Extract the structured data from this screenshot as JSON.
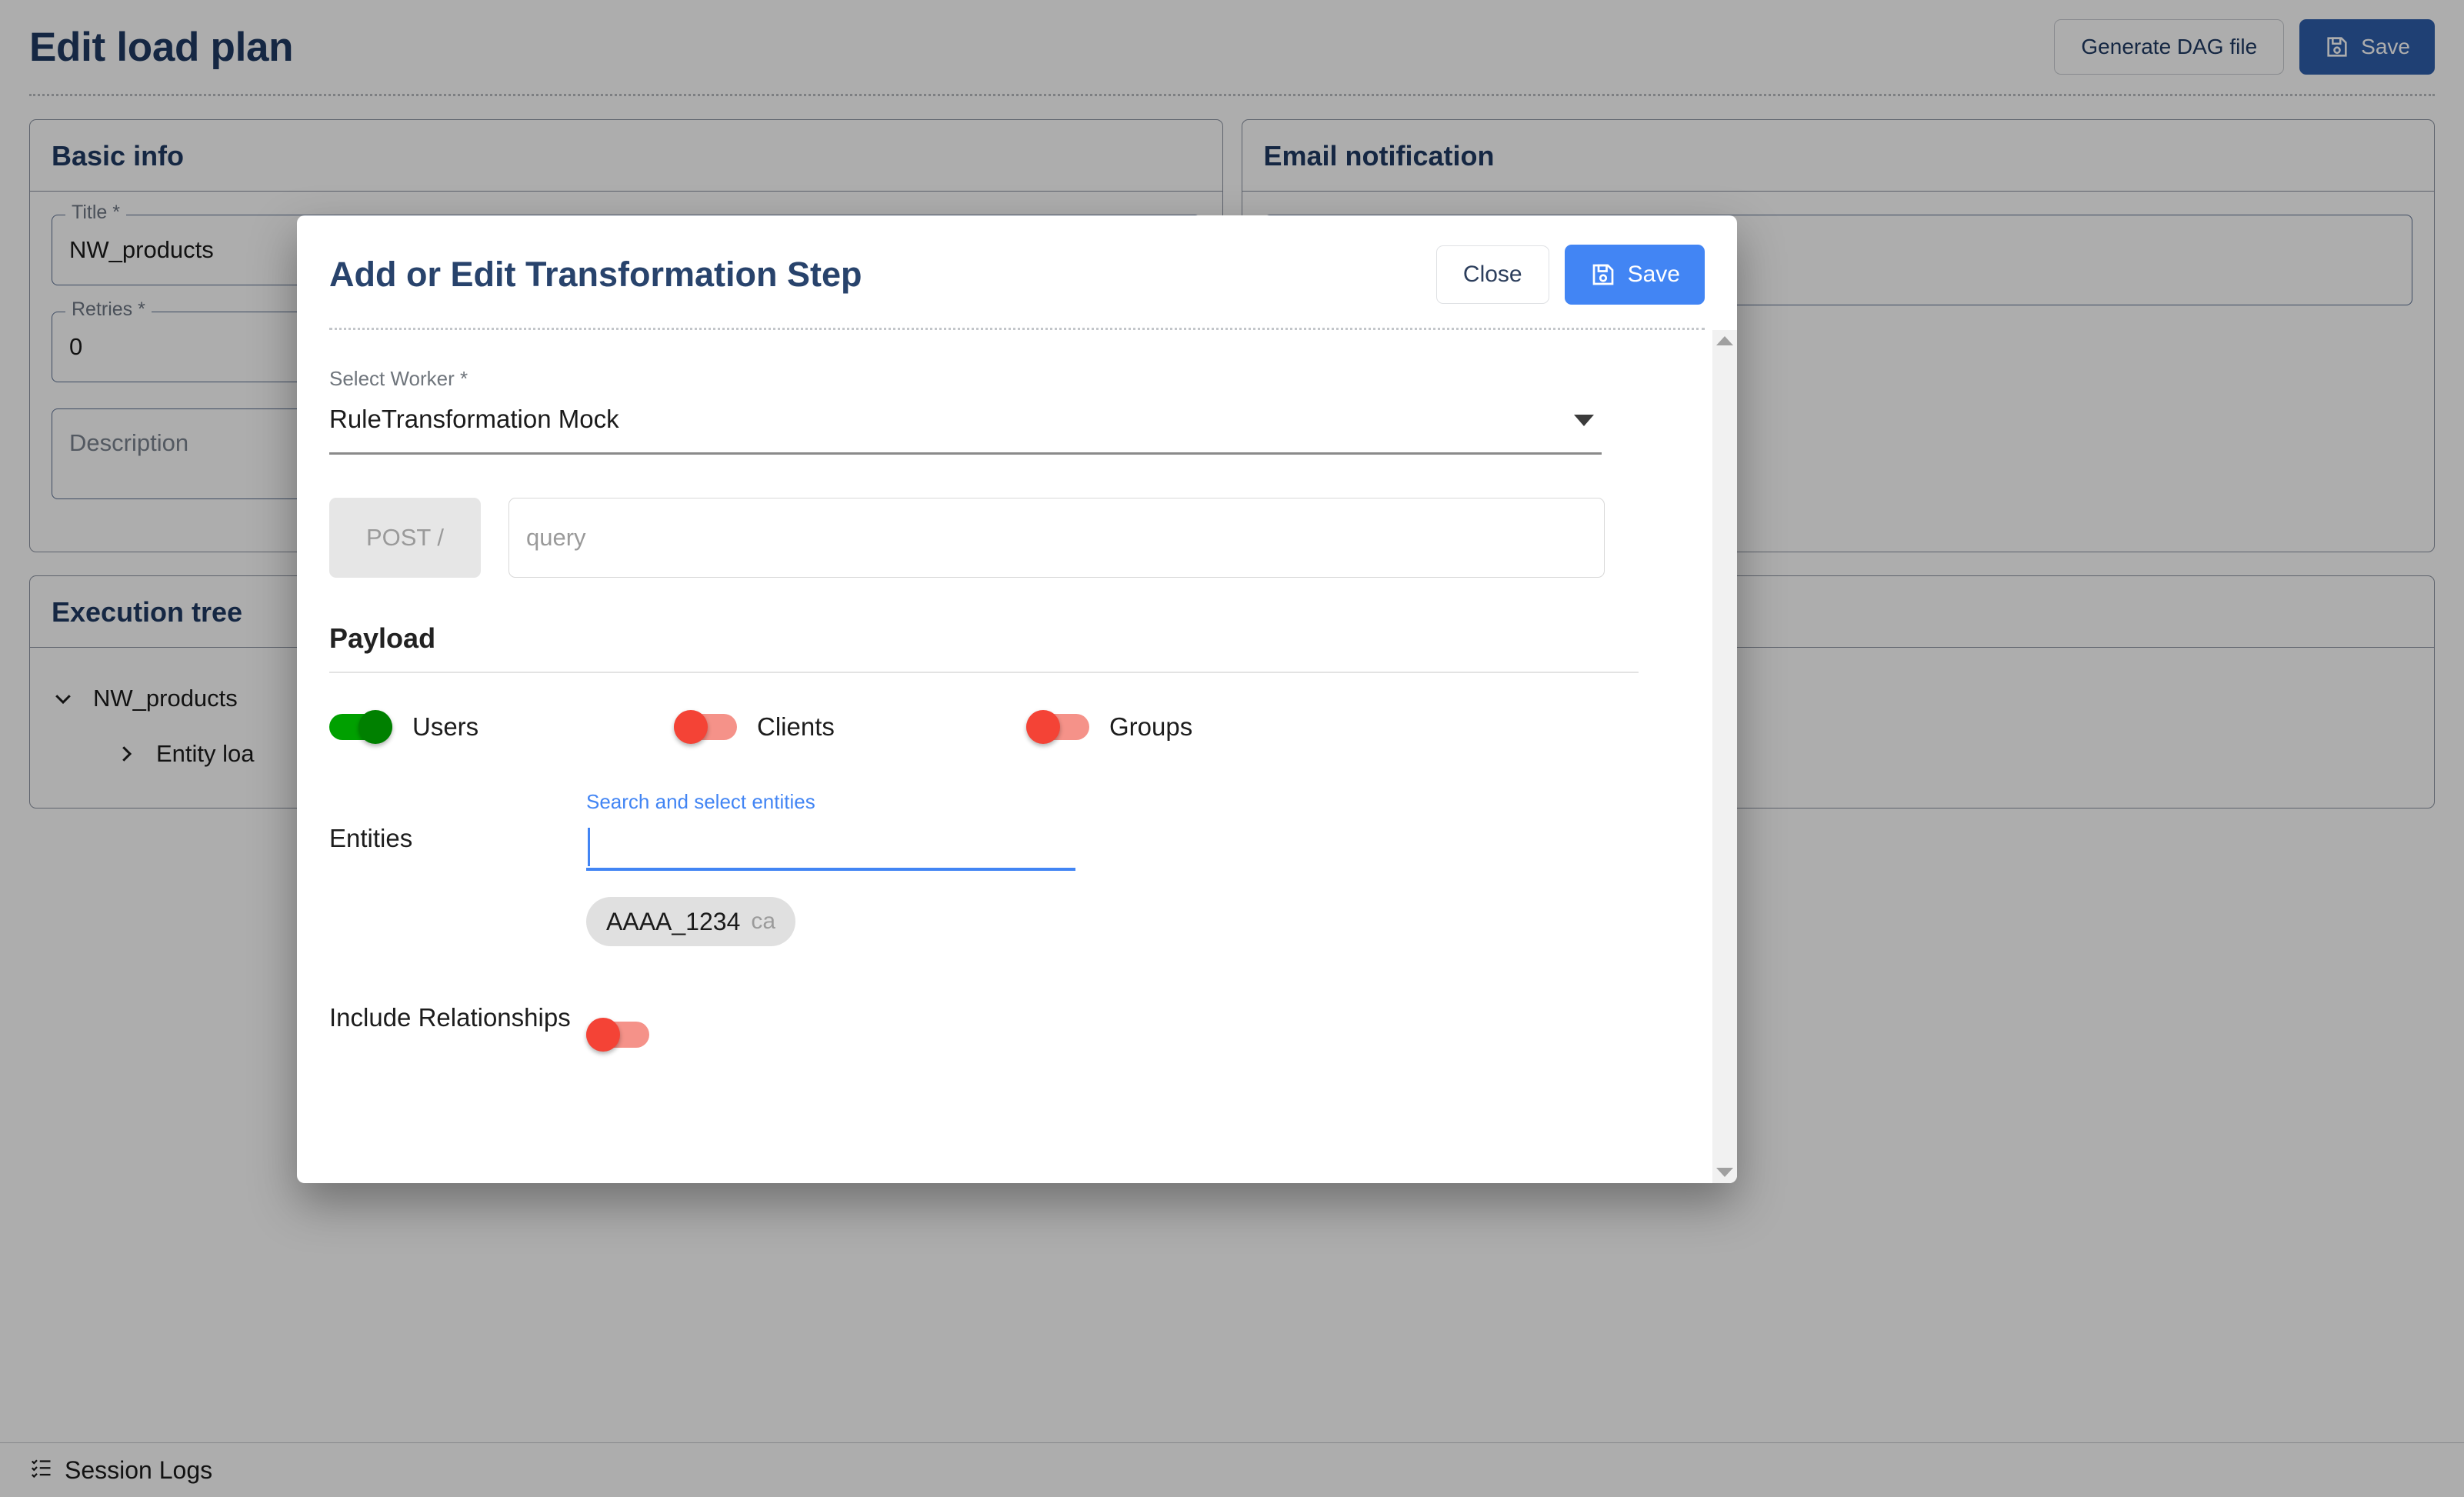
{
  "page": {
    "title": "Edit load plan",
    "header_actions": {
      "generate_dag_label": "Generate DAG file",
      "save_label": "Save",
      "save_icon": "save-disk-icon"
    },
    "basic_info": {
      "panel_title": "Basic info",
      "title_field": {
        "legend": "Title *",
        "value": "NW_products"
      },
      "retries_field": {
        "legend": "Retries *",
        "value": "0"
      },
      "description_field": {
        "placeholder": "Description",
        "value": ""
      }
    },
    "email_notification": {
      "panel_title": "Email notification"
    },
    "execution_tree": {
      "panel_title": "Execution tree",
      "nodes": [
        {
          "label": "NW_products",
          "expanded": true,
          "icon": "chevron-down-icon"
        },
        {
          "label": "Entity loa",
          "expanded": false,
          "icon": "chevron-right-icon"
        }
      ]
    },
    "session_logs": {
      "label": "Session Logs",
      "icon": "checklist-icon"
    }
  },
  "modal": {
    "title": "Add or Edit Transformation Step",
    "close_label": "Close",
    "save_label": "Save",
    "save_icon": "save-disk-icon",
    "select_worker": {
      "label": "Select Worker *",
      "value": "RuleTransformation Mock",
      "caret_icon": "chevron-down-icon"
    },
    "request": {
      "method_label": "POST /",
      "query_placeholder": "query",
      "query_value": ""
    },
    "payload": {
      "heading": "Payload",
      "toggles": [
        {
          "label": "Users",
          "state": "on",
          "color": "#00a000"
        },
        {
          "label": "Clients",
          "state": "off",
          "color": "#f44336"
        },
        {
          "label": "Groups",
          "state": "off",
          "color": "#f44336"
        }
      ],
      "entities": {
        "label": "Entities",
        "hint": "Search and select entities",
        "input_value": "",
        "chips": [
          {
            "text": "AAAA_1234",
            "cancel_label": "ca",
            "cancel_icon": "cancel-icon"
          }
        ]
      },
      "include_relationships": {
        "label": "Include Relationships",
        "state": "off",
        "color": "#f44336"
      }
    },
    "scrollbar": {
      "up_icon": "scroll-up-arrow-icon",
      "down_icon": "scroll-down-arrow-icon"
    }
  }
}
